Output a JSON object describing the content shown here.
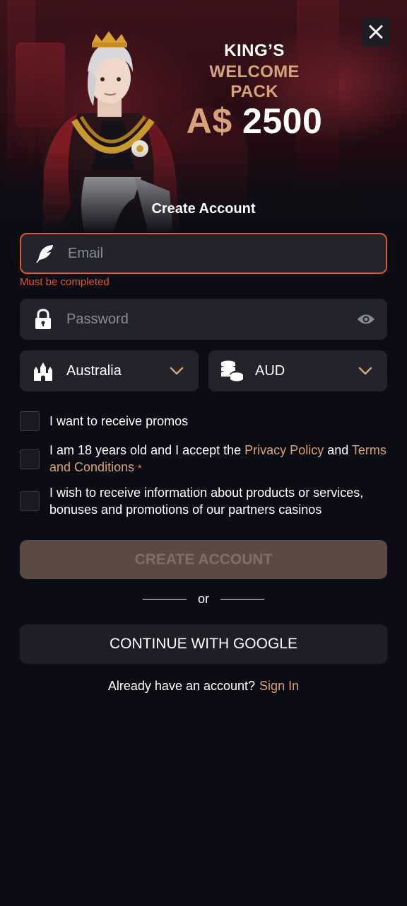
{
  "colors": {
    "accent": "#d7a27a",
    "error": "#e0542f",
    "background": "#0c0d14",
    "field_bg": "#22232b",
    "create_button_bg": "#5b4a43"
  },
  "promo": {
    "line1": "KING’S",
    "line2": "WELCOME PACK",
    "currency": "A$",
    "amount": "2500"
  },
  "form": {
    "title": "Create Account",
    "email": {
      "placeholder": "Email",
      "value": "",
      "error": "Must be completed",
      "icon": "feather-icon"
    },
    "password": {
      "placeholder": "Password",
      "value": "",
      "icon": "lock-icon",
      "toggle_icon": "eye-icon"
    },
    "country": {
      "value": "Australia",
      "icon": "castle-icon"
    },
    "currency": {
      "value": "AUD",
      "icon": "coins-icon"
    },
    "checkboxes": [
      {
        "text": "I want to receive promos",
        "checked": false
      },
      {
        "pre": "I am 18 years old and I accept the ",
        "link1": "Privacy Policy",
        "mid": " and ",
        "link2": "Terms and Conditions",
        "required_mark": "*",
        "checked": false
      },
      {
        "text": "I wish to receive information about products or services, bonuses and promotions of our partners casinos",
        "checked": false
      }
    ],
    "create_button": "CREATE ACCOUNT",
    "or": "or",
    "google_button": "CONTINUE WITH GOOGLE",
    "signin_prompt": "Already have an account?",
    "signin_link": "Sign In"
  }
}
